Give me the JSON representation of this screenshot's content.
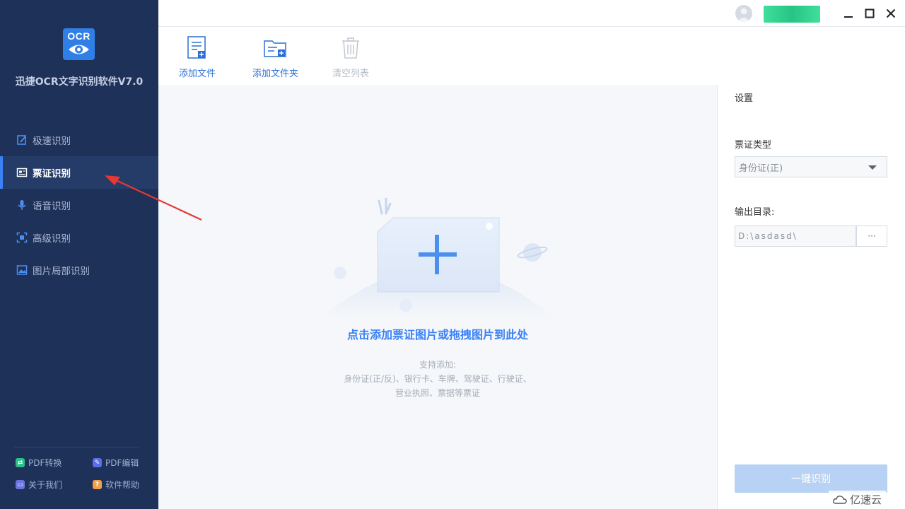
{
  "app": {
    "logo_text": "OCR",
    "name": "迅捷OCR文字识别软件V7.0"
  },
  "sidebar": {
    "items": [
      {
        "label": "极速识别",
        "icon": "quick-recognition-icon"
      },
      {
        "label": "票证识别",
        "icon": "card-recognition-icon",
        "active": true
      },
      {
        "label": "语音识别",
        "icon": "microphone-icon"
      },
      {
        "label": "高级识别",
        "icon": "scan-frame-icon"
      },
      {
        "label": "图片局部识别",
        "icon": "image-crop-icon"
      }
    ],
    "bottom_links": [
      {
        "label": "PDF转换",
        "icon": "pdf-convert-icon",
        "color": "#2bbf8a"
      },
      {
        "label": "PDF编辑",
        "icon": "pdf-edit-icon",
        "color": "#5a6ee8"
      },
      {
        "label": "关于我们",
        "icon": "about-icon",
        "color": "#6b74e0"
      },
      {
        "label": "软件帮助",
        "icon": "help-icon",
        "color": "#f0a04b"
      }
    ]
  },
  "toolbar": {
    "add_file": "添加文件",
    "add_folder": "添加文件夹",
    "clear_list": "清空列表"
  },
  "drop_zone": {
    "title": "点击添加票证图片或拖拽图片到此处",
    "support_heading": "支持添加:",
    "support_line1": "身份证(正/反)、银行卡、车牌、驾驶证、行驶证、",
    "support_line2": "营业执照、票据等票证"
  },
  "settings": {
    "title": "设置",
    "type_label": "票证类型",
    "type_value": "身份证(正)",
    "output_label": "输出目录:",
    "output_value": "D:\\asdasd\\",
    "browse_label": "···",
    "recognize_button": "一键识别"
  },
  "watermark": {
    "text": "亿速云"
  },
  "colors": {
    "sidebar_bg": "#1d3159",
    "accent": "#3b82f6",
    "primary_btn_disabled": "#b7d2f4",
    "arrow": "#e53935"
  }
}
